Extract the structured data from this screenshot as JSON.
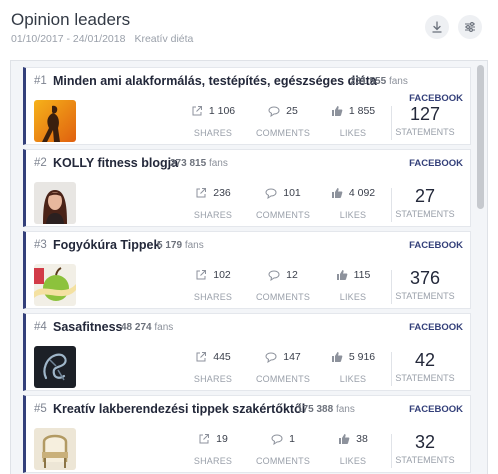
{
  "header": {
    "title": "Opinion leaders",
    "date_range": "01/10/2017 - 24/01/2018",
    "topic": "Kreatív diéta",
    "download_icon": "download-icon",
    "settings_icon": "sliders-icon"
  },
  "labels": {
    "shares": "SHARES",
    "comments": "COMMENTS",
    "likes": "LIKES",
    "statements": "STATEMENTS",
    "fans_suffix": "fans"
  },
  "colors": {
    "accent": "#34407a",
    "panel_bg": "#f3f5f8"
  },
  "leaders": [
    {
      "rank": "#1",
      "name": "Minden ami alakformálás, testépítés, egészséges diéta",
      "fans": "231 555",
      "platform": "FACEBOOK",
      "shares": "1 106",
      "comments": "25",
      "likes": "1 855",
      "statements": "127",
      "avatar": "runner-silhouette-avatar"
    },
    {
      "rank": "#2",
      "name": "KOLLY fitness blogja",
      "fans": "273 815",
      "platform": "FACEBOOK",
      "shares": "236",
      "comments": "101",
      "likes": "4 092",
      "statements": "27",
      "avatar": "woman-portrait-avatar"
    },
    {
      "rank": "#3",
      "name": "Fogyókúra Tippek",
      "fans": "5 179",
      "platform": "FACEBOOK",
      "shares": "102",
      "comments": "12",
      "likes": "115",
      "statements": "376",
      "avatar": "apple-tape-measure-avatar"
    },
    {
      "rank": "#4",
      "name": "Sasafitness",
      "fans": "48 274",
      "platform": "FACEBOOK",
      "shares": "445",
      "comments": "147",
      "likes": "5 916",
      "statements": "42",
      "avatar": "dark-logo-avatar"
    },
    {
      "rank": "#5",
      "name": "Kreatív lakberendezési tippek szakértőktől",
      "fans": "175 388",
      "platform": "FACEBOOK",
      "shares": "19",
      "comments": "1",
      "likes": "38",
      "statements": "32",
      "avatar": "interior-chair-avatar"
    }
  ]
}
